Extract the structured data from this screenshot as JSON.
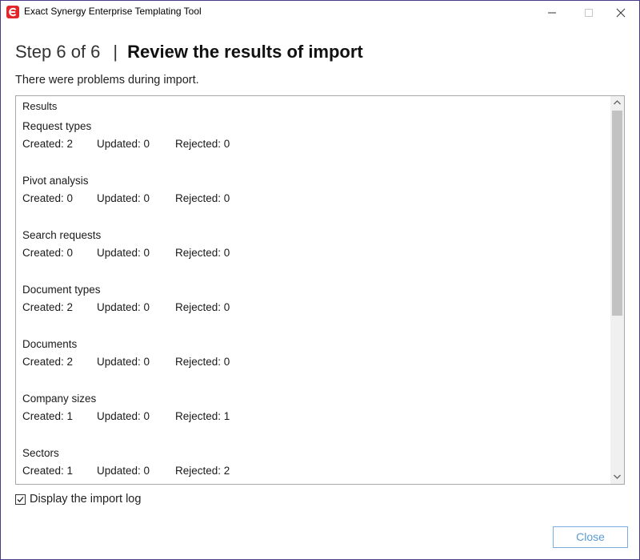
{
  "window": {
    "title": "Exact Synergy Enterprise Templating Tool",
    "icon": "exact-logo-icon",
    "accent_color": "#e3262a"
  },
  "header": {
    "step": "Step 6 of 6",
    "separator": "|",
    "title": "Review the results of import"
  },
  "message": "There were problems during import.",
  "results": {
    "heading": "Results",
    "sections": [
      {
        "name": "Request types",
        "created": "Created: 2",
        "updated": "Updated: 0",
        "rejected": "Rejected: 0"
      },
      {
        "name": "Pivot analysis",
        "created": "Created: 0",
        "updated": "Updated: 0",
        "rejected": "Rejected: 0"
      },
      {
        "name": "Search requests",
        "created": "Created: 0",
        "updated": "Updated: 0",
        "rejected": "Rejected: 0"
      },
      {
        "name": "Document types",
        "created": "Created: 2",
        "updated": "Updated: 0",
        "rejected": "Rejected: 0"
      },
      {
        "name": "Documents",
        "created": "Created: 2",
        "updated": "Updated: 0",
        "rejected": "Rejected: 0"
      },
      {
        "name": "Company sizes",
        "created": "Created: 1",
        "updated": "Updated: 0",
        "rejected": "Rejected: 1"
      },
      {
        "name": "Sectors",
        "created": "Created: 1",
        "updated": "Updated: 0",
        "rejected": "Rejected: 2"
      }
    ]
  },
  "display_log": {
    "label": "Display the import log",
    "checked": true
  },
  "buttons": {
    "close_label": "Close"
  }
}
